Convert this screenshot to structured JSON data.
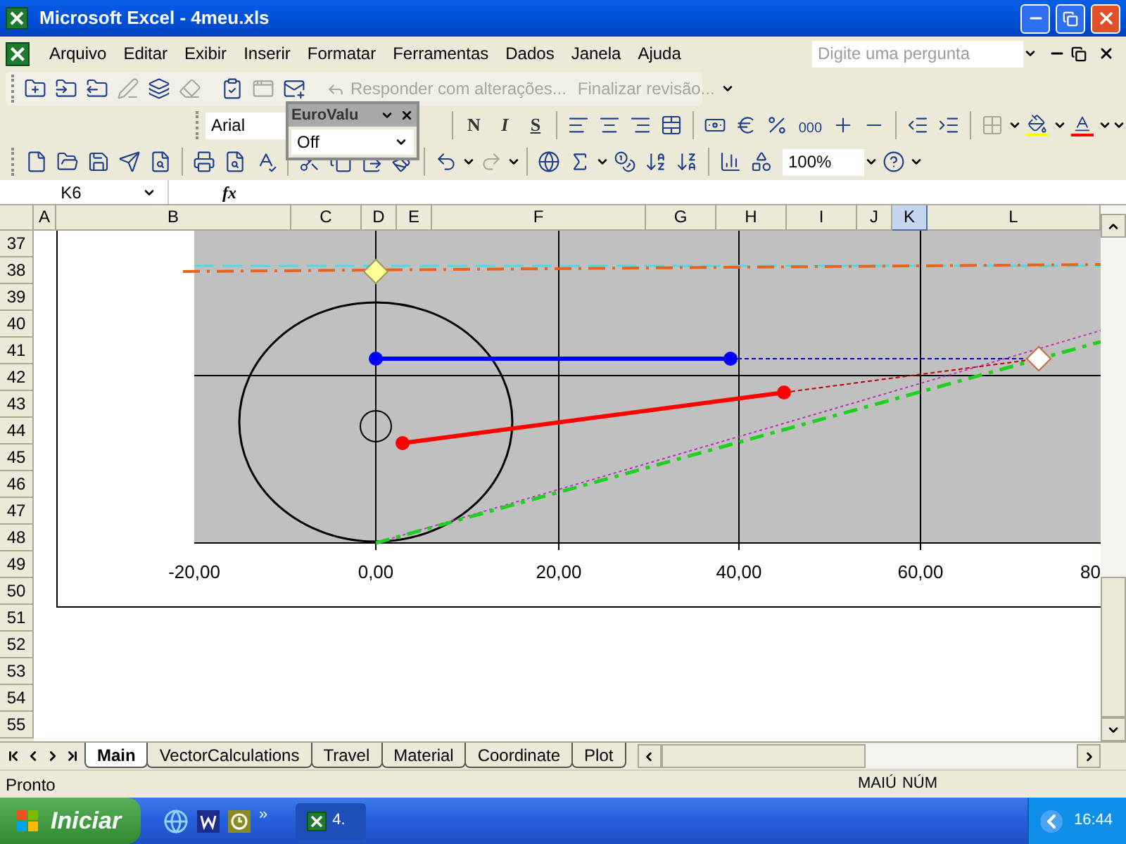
{
  "window": {
    "title": "Microsoft Excel - 4meu.xls"
  },
  "menu": [
    {
      "label": "Arquivo"
    },
    {
      "label": "Editar"
    },
    {
      "label": "Exibir"
    },
    {
      "label": "Inserir"
    },
    {
      "label": "Formatar"
    },
    {
      "label": "Ferramentas"
    },
    {
      "label": "Dados"
    },
    {
      "label": "Janela"
    },
    {
      "label": "Ajuda"
    }
  ],
  "help_box": {
    "placeholder": "Digite uma pergunta"
  },
  "reviewing_toolbar": {
    "buttons": [
      {
        "label": "Responder com alterações...",
        "disabled": true
      },
      {
        "label": "Finalizar revisão...",
        "disabled": true
      }
    ]
  },
  "formatting_toolbar": {
    "font": "Arial",
    "style_buttons": [
      "N",
      "I",
      "S"
    ],
    "thousands_button": "000"
  },
  "eurovalue_palette": {
    "title": "EuroValu",
    "value": "Off"
  },
  "standard_toolbar": {
    "zoom": "100%"
  },
  "formula_bar": {
    "name_box": "K6",
    "fx_label": "fx"
  },
  "columns": [
    {
      "label": "A",
      "selected": false
    },
    {
      "label": "B",
      "selected": false
    },
    {
      "label": "C",
      "selected": false
    },
    {
      "label": "D",
      "selected": false
    },
    {
      "label": "E",
      "selected": false
    },
    {
      "label": "F",
      "selected": false
    },
    {
      "label": "G",
      "selected": false
    },
    {
      "label": "H",
      "selected": false
    },
    {
      "label": "I",
      "selected": false
    },
    {
      "label": "J",
      "selected": false
    },
    {
      "label": "K",
      "selected": true
    },
    {
      "label": "L",
      "selected": false
    }
  ],
  "rows": [
    "37",
    "38",
    "39",
    "40",
    "41",
    "42",
    "43",
    "44",
    "45",
    "46",
    "47",
    "48",
    "49",
    "50",
    "51",
    "52",
    "53",
    "54",
    "55"
  ],
  "chart": {
    "x_axis_labels": [
      "-20,00",
      "0,00",
      "20,00",
      "40,00",
      "60,00",
      "80"
    ]
  },
  "sheet_tabs": [
    {
      "label": "Main",
      "selected": true
    },
    {
      "label": "VectorCalculations",
      "selected": false
    },
    {
      "label": "Travel",
      "selected": false
    },
    {
      "label": "Material",
      "selected": false
    },
    {
      "label": "Coordinate",
      "selected": false
    },
    {
      "label": "Plot",
      "selected": false
    }
  ],
  "status_bar": {
    "status": "Pronto",
    "indicators": [
      "MAIÚ",
      "NÚM"
    ]
  },
  "taskbar": {
    "start": "Iniciar",
    "overflow": "»",
    "tasks": [
      "4."
    ],
    "clock": "16:44"
  }
}
